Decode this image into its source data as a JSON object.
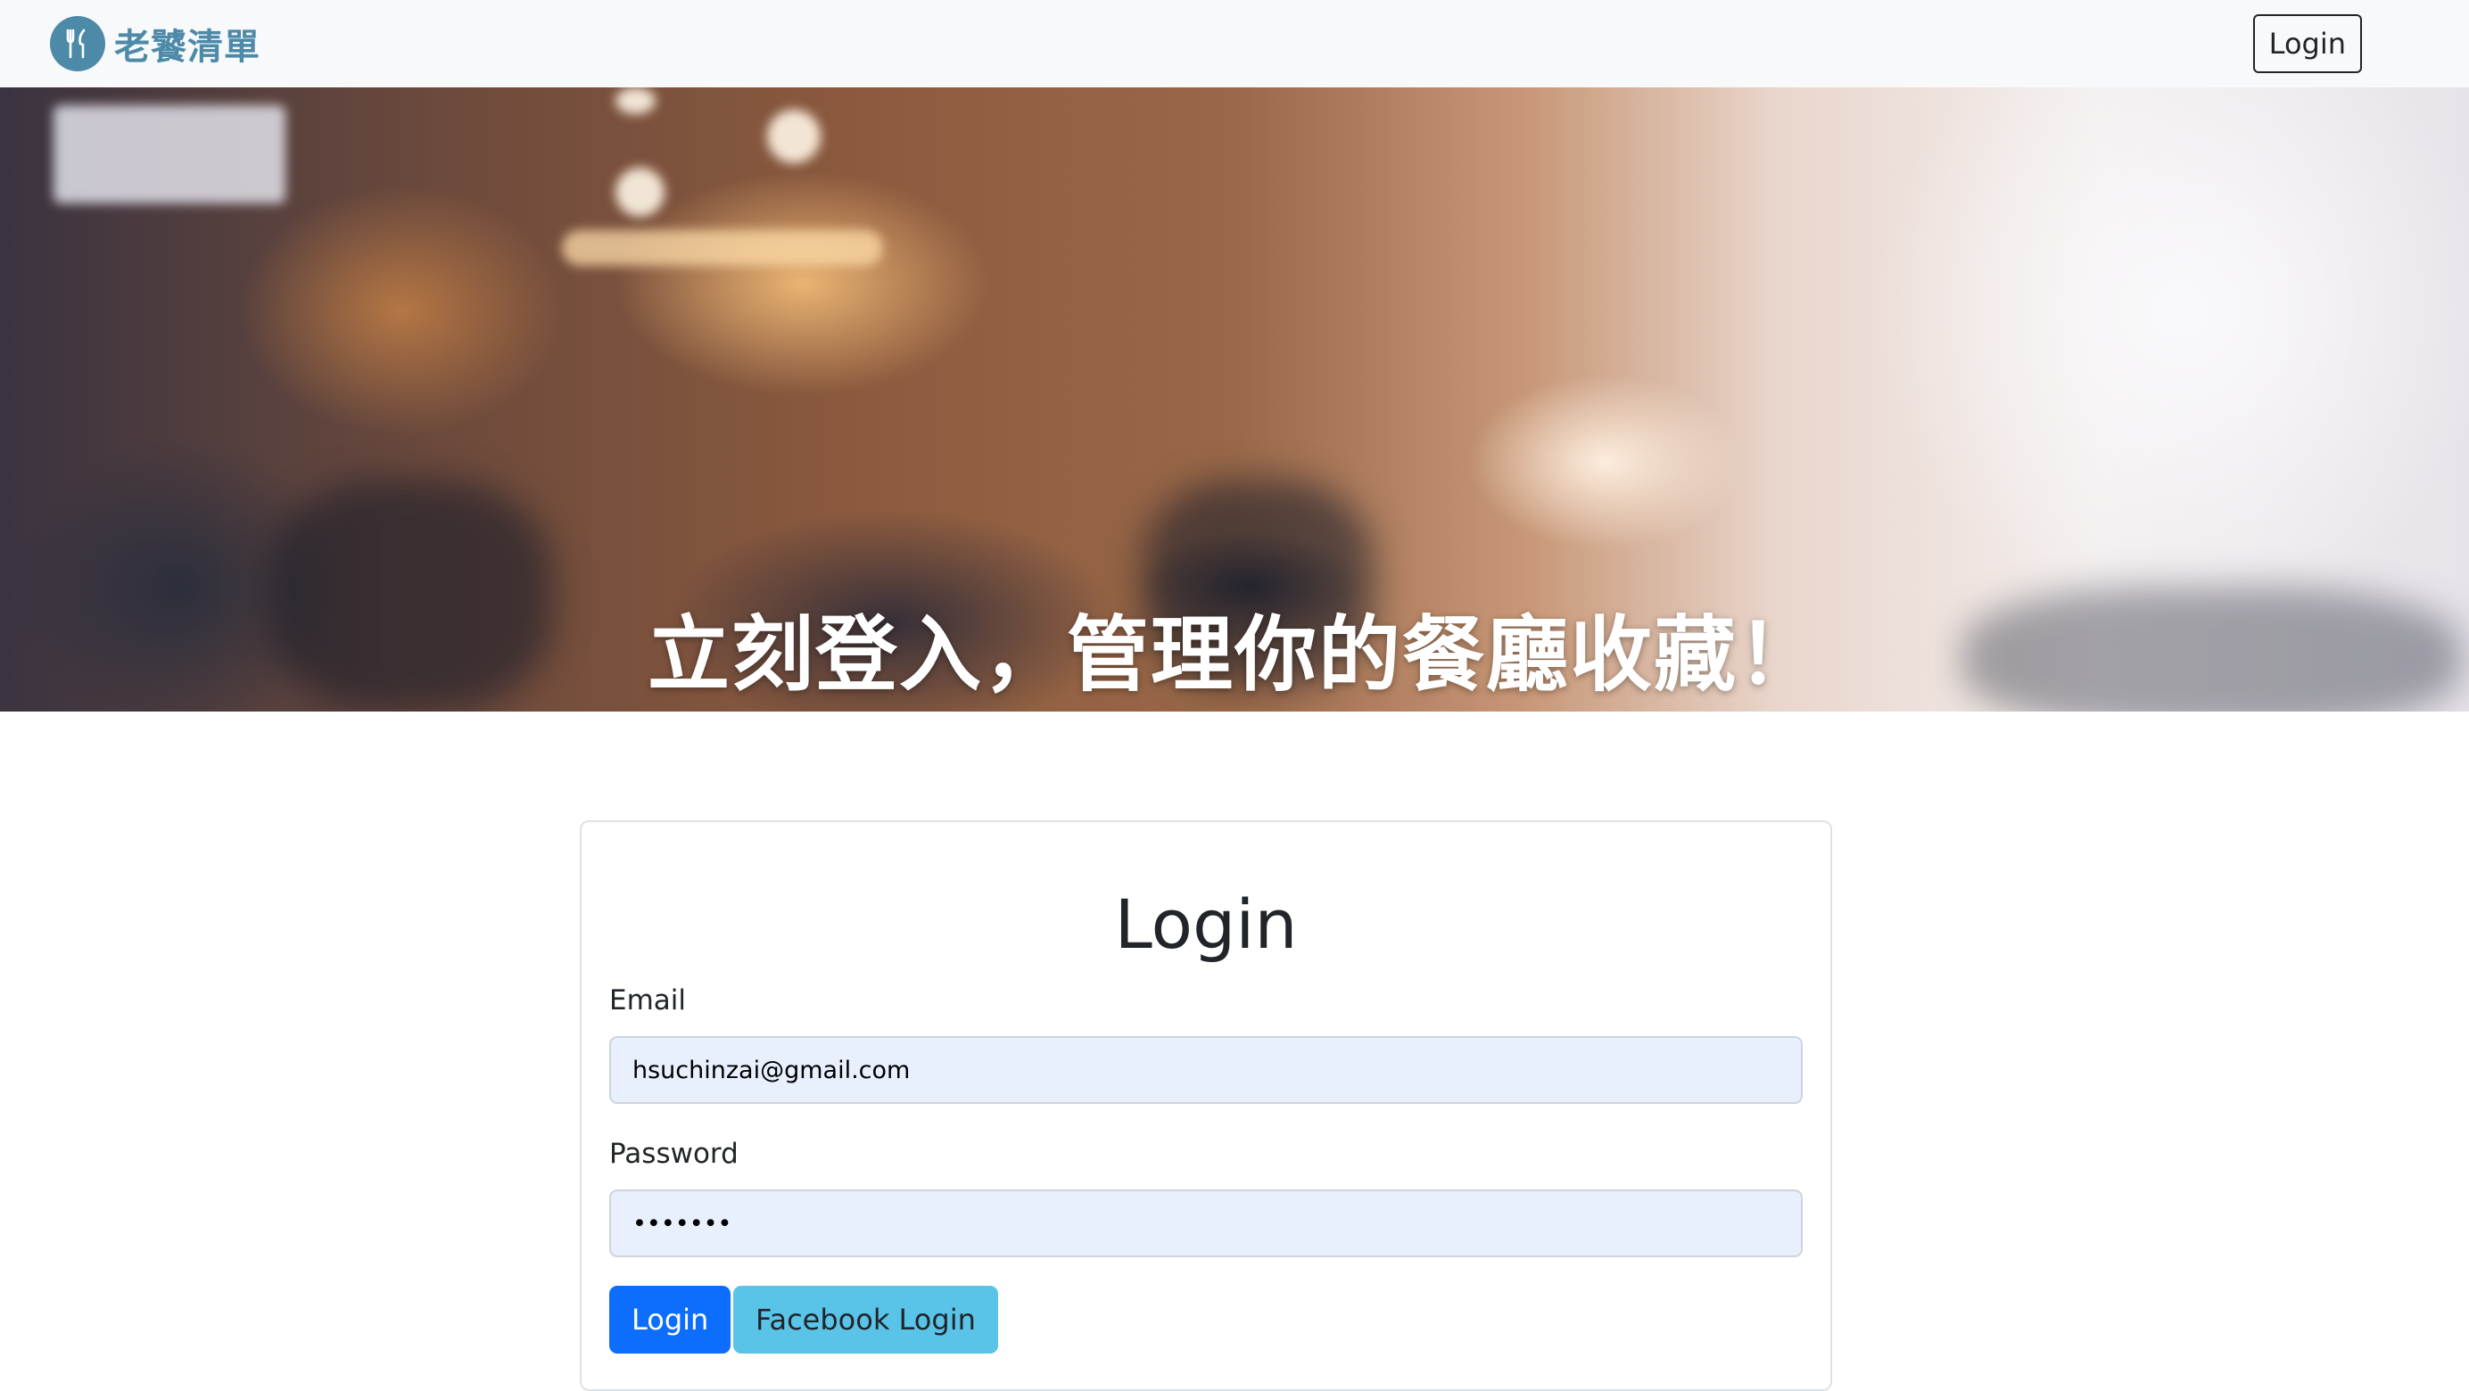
{
  "navbar": {
    "brand_text": "老饕清單",
    "brand_icon": "utensils-icon",
    "login_label": "Login",
    "brand_color": "#4d8aa8"
  },
  "banner": {
    "title": "立刻登入，管理你的餐廳收藏！"
  },
  "login_form": {
    "title": "Login",
    "email_label": "Email",
    "email_value": "hsuchinzai@gmail.com",
    "password_label": "Password",
    "password_value": "•••••••",
    "submit_label": "Login",
    "facebook_label": "Facebook Login",
    "primary_color": "#0d6efd",
    "facebook_button_color": "#5ac3e8",
    "input_background": "#e8f0fe"
  }
}
